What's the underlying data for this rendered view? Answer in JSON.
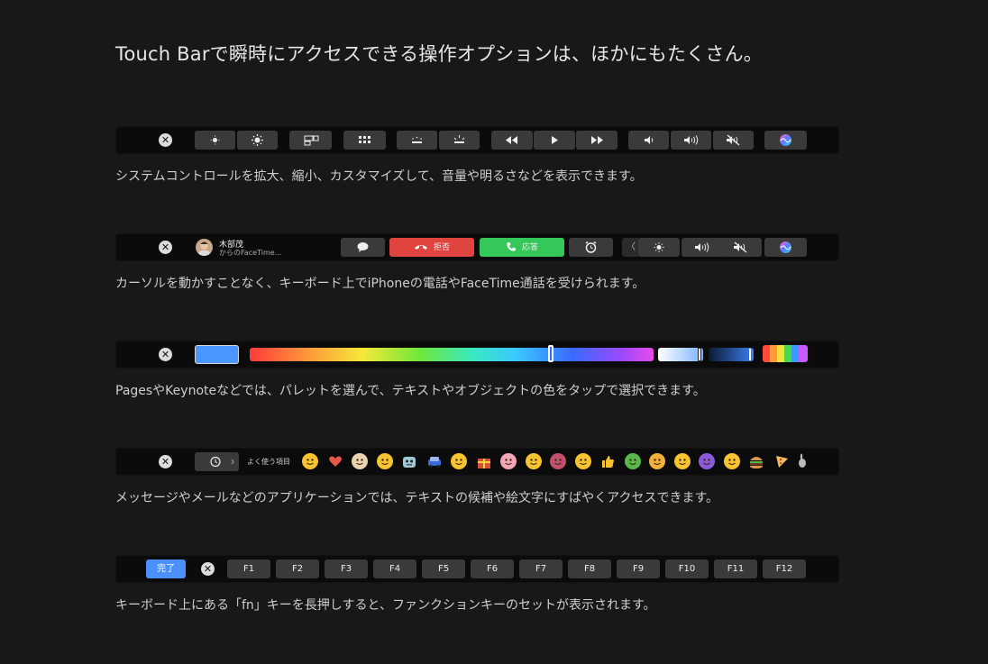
{
  "title": "Touch Barで瞬時にアクセスできる操作オプションは、ほかにもたくさん。",
  "sections": [
    {
      "caption": "システムコントロールを拡大、縮小、カスタマイズして、音量や明るさなどを表示できます。"
    },
    {
      "caption": "カーソルを動かすことなく、キーボード上でiPhoneの電話やFaceTime通話を受けられます。"
    },
    {
      "caption": "PagesやKeynoteなどでは、パレットを選んで、テキストやオブジェクトの色をタップで選択できます。"
    },
    {
      "caption": "メッセージやメールなどのアプリケーションでは、テキストの候補や絵文字にすばやくアクセスできます。"
    },
    {
      "caption": "キーボード上にある「fn」キーを長押しすると、ファンクションキーのセットが表示されます。"
    }
  ],
  "call": {
    "caller_name": "木部茂",
    "caller_sub": "からのFaceTime...",
    "decline_label": "拒否",
    "accept_label": "応答",
    "decline_color": "#e0443e",
    "accept_color": "#35c759"
  },
  "emoji_bar": {
    "frequent_label": "よく使う項目",
    "icons": [
      "smiling-face",
      "heart",
      "old-woman",
      "tongue-face",
      "robot",
      "car",
      "hugging-face",
      "gift",
      "pig",
      "upside-down-face",
      "octopus",
      "sunglasses-face",
      "thumbs-up",
      "frog",
      "heart-eyes-cat",
      "smirk-face",
      "alien-monster",
      "kissing-face",
      "hamburger",
      "pizza",
      "rabbit"
    ]
  },
  "fn_bar": {
    "done_label": "完了",
    "done_color": "#4a90ff",
    "keys": [
      "F1",
      "F2",
      "F3",
      "F4",
      "F5",
      "F6",
      "F7",
      "F8",
      "F9",
      "F10",
      "F11",
      "F12"
    ]
  },
  "colors": {
    "background": "#181818",
    "bar_background": "#0b0b0b",
    "key_background": "#3a3a3a",
    "selected_swatch": "#4a97ff"
  }
}
